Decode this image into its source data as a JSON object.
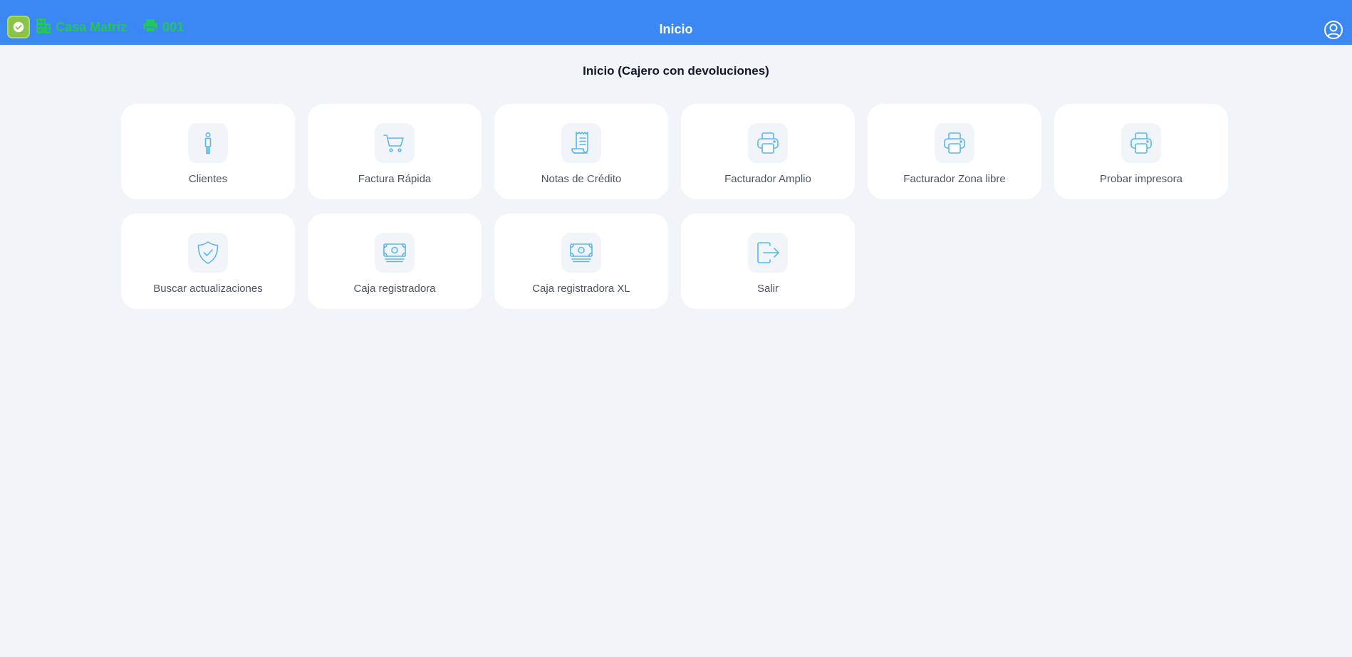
{
  "header": {
    "title": "Inicio",
    "branch": "Casa Matriz",
    "register": "001",
    "colors": {
      "bar": "#3b88f5",
      "status_text": "#22c55e",
      "logo": "#8bc34a"
    },
    "icons": {
      "logo": "check-badge-icon",
      "branch": "building-icon",
      "register": "printer-icon",
      "user": "user-circle-icon"
    }
  },
  "main": {
    "heading": "Inicio (Cajero con devoluciones)",
    "icon_color": "#5cb8e6",
    "tiles": [
      {
        "label": "Clientes",
        "icon": "person-icon"
      },
      {
        "label": "Factura Rápida",
        "icon": "cart-icon"
      },
      {
        "label": "Notas de Crédito",
        "icon": "receipt-icon"
      },
      {
        "label": "Facturador Amplio",
        "icon": "printer-icon"
      },
      {
        "label": "Facturador Zona libre",
        "icon": "printer-icon"
      },
      {
        "label": "Probar impresora",
        "icon": "printer-icon"
      },
      {
        "label": "Buscar actualizaciones",
        "icon": "shield-check-icon"
      },
      {
        "label": "Caja registradora",
        "icon": "cash-icon"
      },
      {
        "label": "Caja registradora XL",
        "icon": "cash-icon"
      },
      {
        "label": "Salir",
        "icon": "logout-icon"
      }
    ]
  }
}
